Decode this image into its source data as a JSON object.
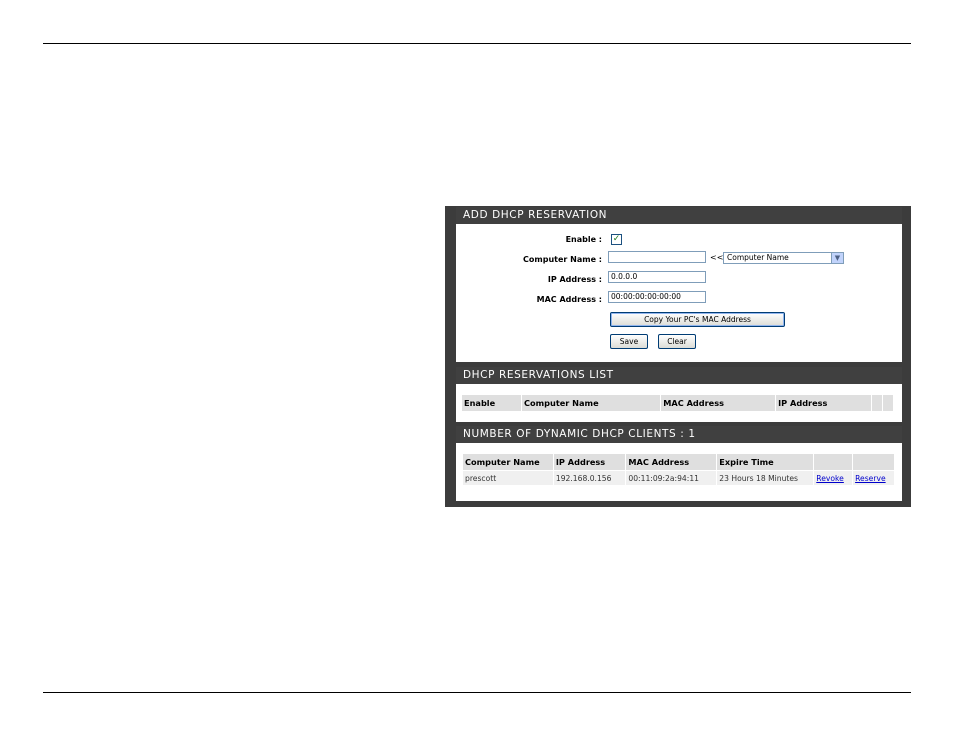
{
  "add_reservation": {
    "title": "ADD DHCP RESERVATION",
    "enable_label": "Enable :",
    "enable_checked": true,
    "computer_name_label": "Computer Name :",
    "computer_name_value": "",
    "arrow_text": "<<",
    "computer_select_value": "Computer Name",
    "ip_label": "IP Address :",
    "ip_value": "0.0.0.0",
    "mac_label": "MAC Address :",
    "mac_value": "00:00:00:00:00:00",
    "copy_mac_button": "Copy Your PC's MAC Address",
    "save_button": "Save",
    "clear_button": "Clear"
  },
  "reservations_list": {
    "title": "DHCP RESERVATIONS LIST",
    "columns": [
      "Enable",
      "Computer Name",
      "MAC Address",
      "IP Address"
    ]
  },
  "dynamic_clients": {
    "title": "NUMBER OF DYNAMIC DHCP CLIENTS : 1",
    "columns": [
      "Computer Name",
      "IP Address",
      "MAC Address",
      "Expire Time"
    ],
    "rows": [
      {
        "computer_name": "prescott",
        "ip": "192.168.0.156",
        "mac": "00:11:09:2a:94:11",
        "expire": "23 Hours 18 Minutes",
        "revoke": "Revoke",
        "reserve": "Reserve"
      }
    ]
  }
}
